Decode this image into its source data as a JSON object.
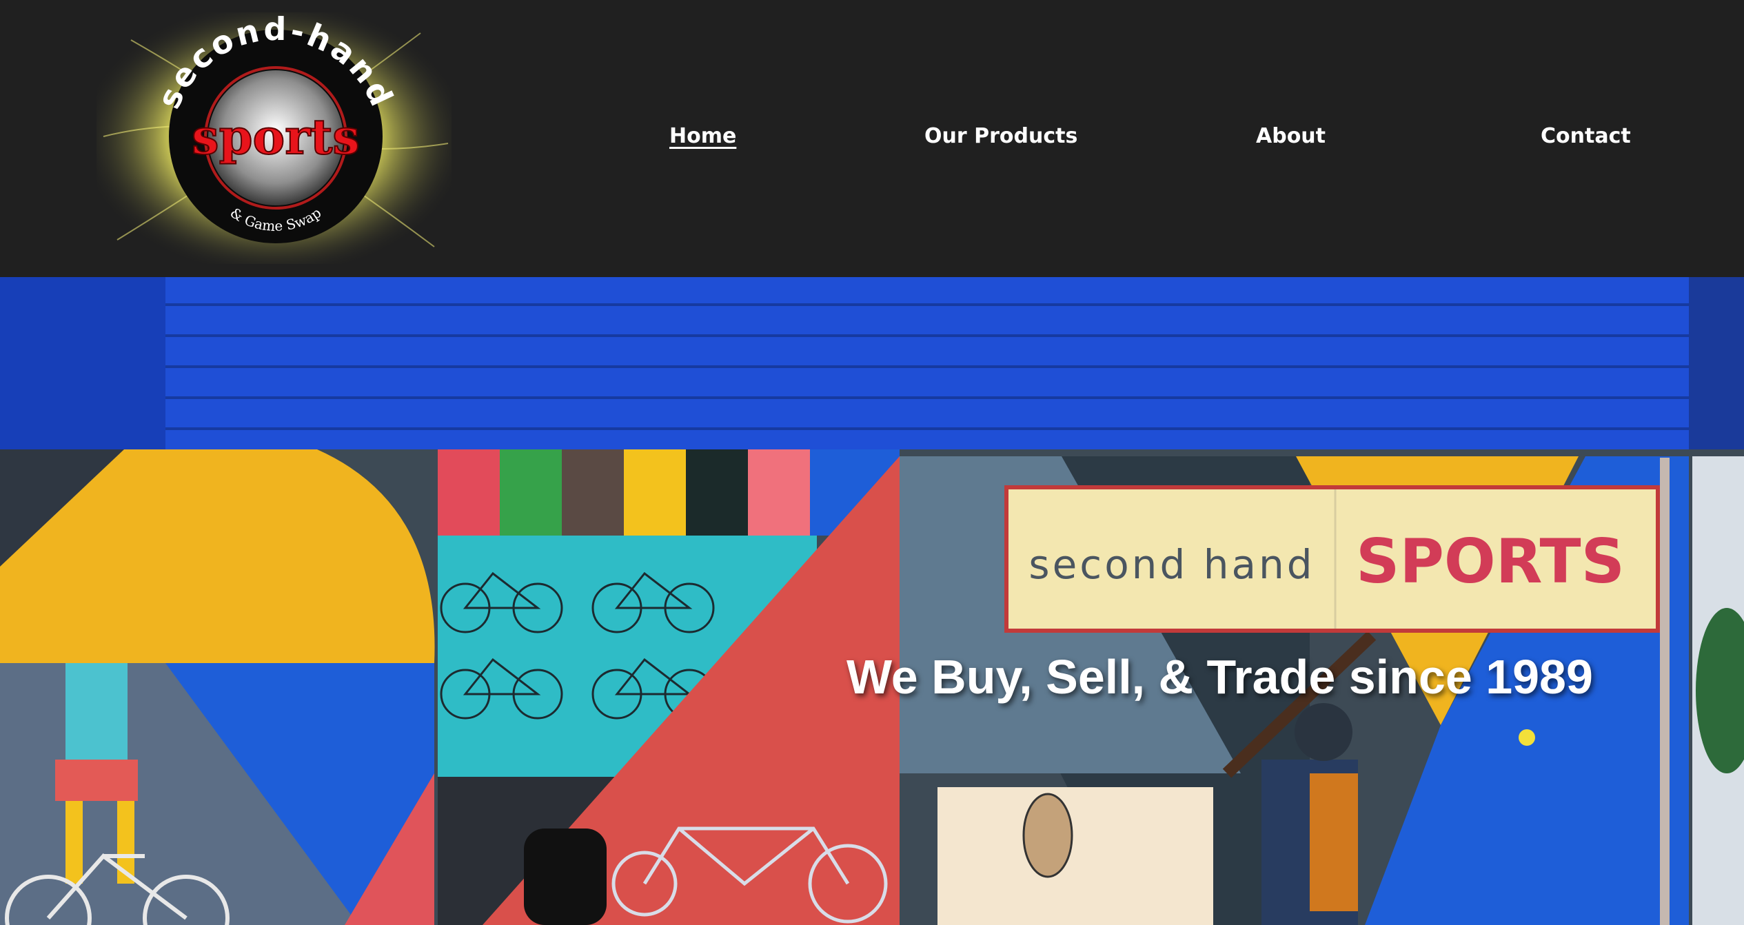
{
  "brand": {
    "logo_top_text": "second-hand",
    "logo_main_text": "sports",
    "logo_bottom_text": "& Game Swap"
  },
  "nav": {
    "items": [
      {
        "label": "Home",
        "active": true
      },
      {
        "label": "Our Products",
        "active": false
      },
      {
        "label": "About",
        "active": false
      },
      {
        "label": "Contact",
        "active": false
      }
    ]
  },
  "hero": {
    "tagline": "We Buy, Sell, & Trade since 1989",
    "sign_left": "second hand",
    "sign_right": "SPORTS"
  },
  "colors": {
    "header_bg": "#202020",
    "roof_blue": "#1f4fd6",
    "sign_red": "#d23c57",
    "mural_yellow": "#f2b21c",
    "mural_teal": "#2fbcc6"
  }
}
